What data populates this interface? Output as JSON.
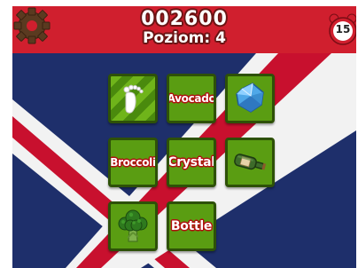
{
  "hud": {
    "score": "002600",
    "level": "Poziom: 4",
    "timer": "15"
  },
  "icons": {
    "settings": "gear-icon",
    "timer": "alarm-clock-icon"
  },
  "colors": {
    "tile_green": "#5a9d12",
    "tile_border": "#2e5108",
    "label_outline": "#b01010",
    "flag_blue": "#1e2f6b",
    "flag_red": "#c8102e"
  },
  "board": {
    "tiles": [
      {
        "kind": "image",
        "icon": "footprint-icon",
        "selected": true
      },
      {
        "kind": "word",
        "label": "Avocado"
      },
      {
        "kind": "image",
        "icon": "crystal-icon"
      },
      {
        "kind": "word",
        "label": "Broccoli"
      },
      {
        "kind": "word",
        "label": "Crystal"
      },
      {
        "kind": "image",
        "icon": "bottle-icon"
      },
      {
        "kind": "image",
        "icon": "broccoli-icon"
      },
      {
        "kind": "word",
        "label": "Bottle"
      }
    ]
  }
}
